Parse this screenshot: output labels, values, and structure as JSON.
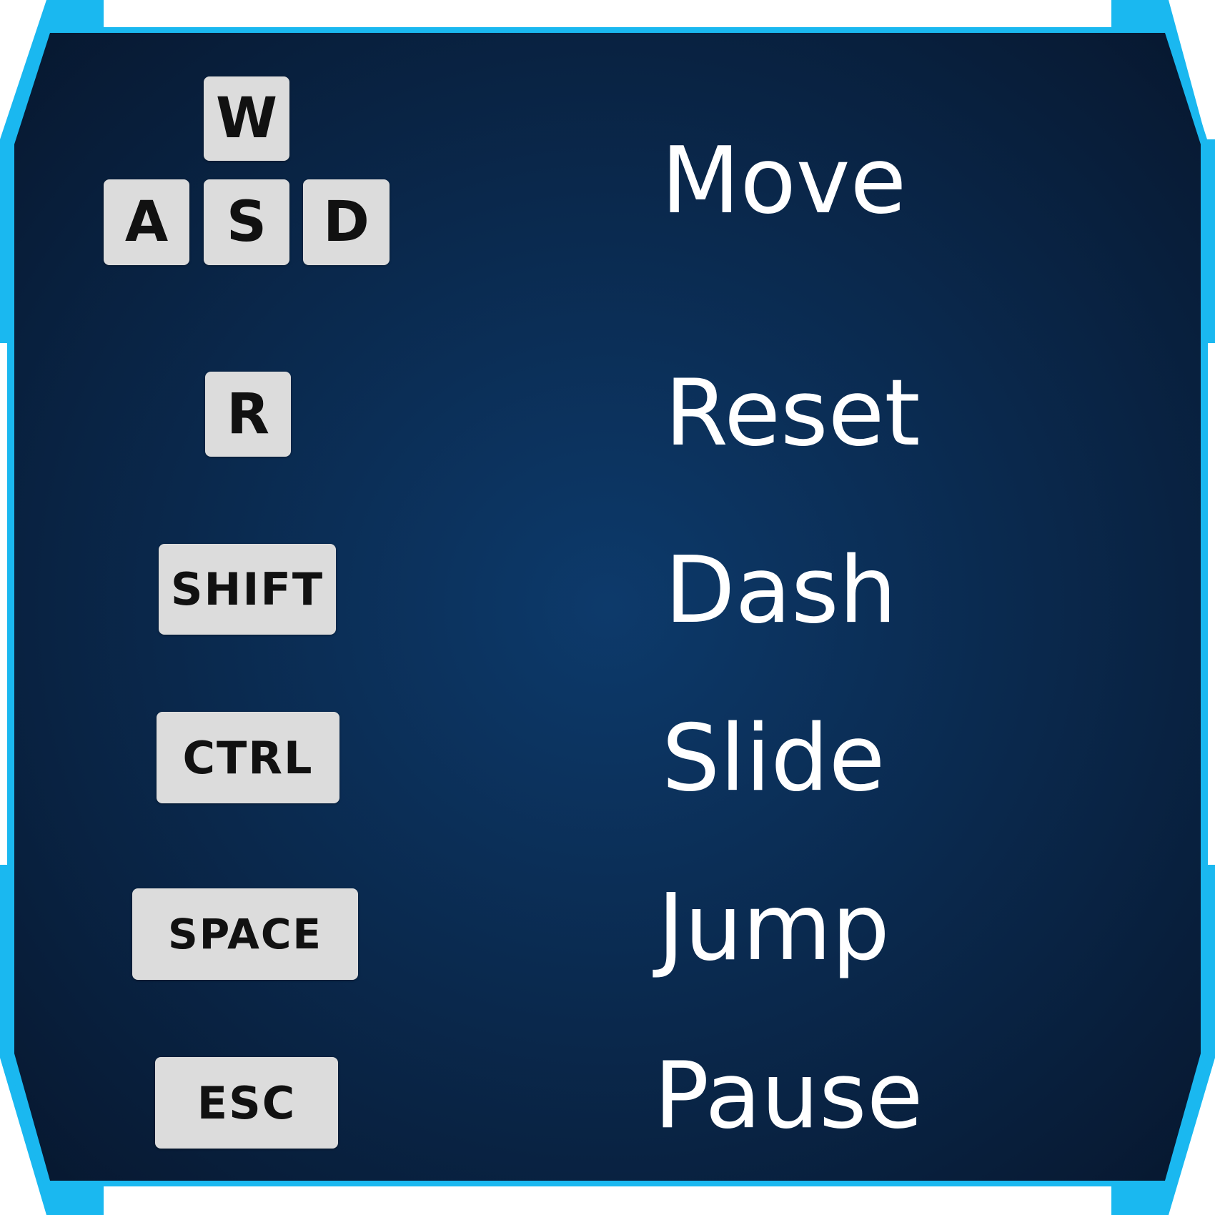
{
  "theme": {
    "panel_center": "#0d3a6b",
    "panel_edge": "#081a36",
    "frame_accent": "#1ab8f0",
    "key_bg": "#dcdcdc",
    "key_text": "#111111",
    "action_text": "#ffffff"
  },
  "controls": [
    {
      "keys": [
        "W",
        "A",
        "S",
        "D"
      ],
      "action": "Move"
    },
    {
      "keys": [
        "R"
      ],
      "action": "Reset"
    },
    {
      "keys": [
        "SHIFT"
      ],
      "action": "Dash"
    },
    {
      "keys": [
        "CTRL"
      ],
      "action": "Slide"
    },
    {
      "keys": [
        "SPACE"
      ],
      "action": "Jump"
    },
    {
      "keys": [
        "ESC"
      ],
      "action": "Pause"
    }
  ]
}
